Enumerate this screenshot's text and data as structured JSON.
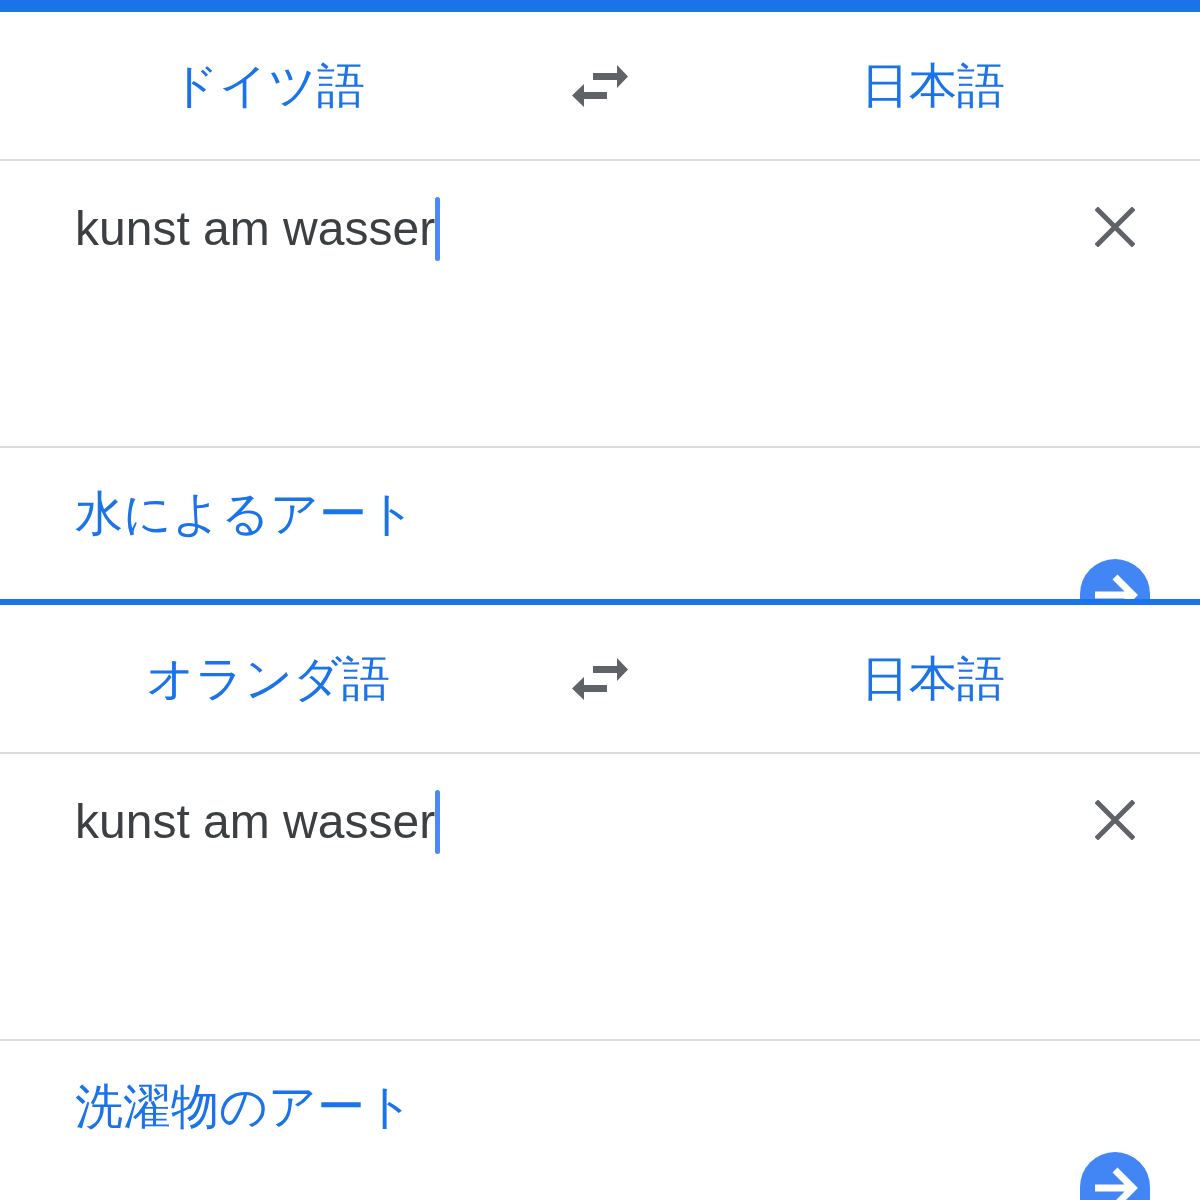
{
  "panels": [
    {
      "source_language": "ドイツ語",
      "target_language": "日本語",
      "input": {
        "value": "kunst am wasser",
        "focused": true
      },
      "translation": "水によるアート"
    },
    {
      "source_language": "オランダ語",
      "target_language": "日本語",
      "input": {
        "value": "kunst am wasser",
        "focused": true
      },
      "translation": "洗濯物のアート"
    }
  ]
}
